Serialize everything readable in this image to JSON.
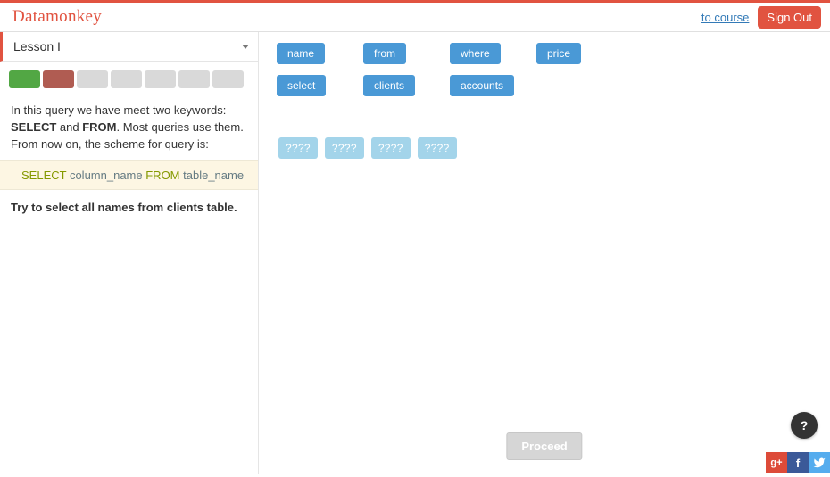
{
  "header": {
    "brand": "Datamonkey",
    "to_course": "to course",
    "sign_out": "Sign Out"
  },
  "lesson": {
    "title": "Lesson I",
    "progress": [
      "green",
      "red",
      "grey",
      "grey",
      "grey",
      "grey",
      "grey"
    ]
  },
  "instructions": {
    "line1_a": "In this query we have meet two keywords: ",
    "kw1": "SELECT",
    "line1_b": " and ",
    "kw2": "FROM",
    "line1_c": ". Most queries use them. From now on, the scheme for query is:"
  },
  "scheme": {
    "kw_select": "SELECT",
    "col": " column_name ",
    "kw_from": "FROM",
    "tbl": " table_name"
  },
  "try_text": "Try to select all names from clients table.",
  "tokens_row1": [
    "name",
    "from",
    "where",
    "price"
  ],
  "tokens_row2": [
    "select",
    "clients",
    "accounts"
  ],
  "slots": [
    "????",
    "????",
    "????",
    "????"
  ],
  "proceed": "Proceed",
  "help": "?",
  "social": {
    "gplus": "g+",
    "fb": "f",
    "tw": "t"
  }
}
